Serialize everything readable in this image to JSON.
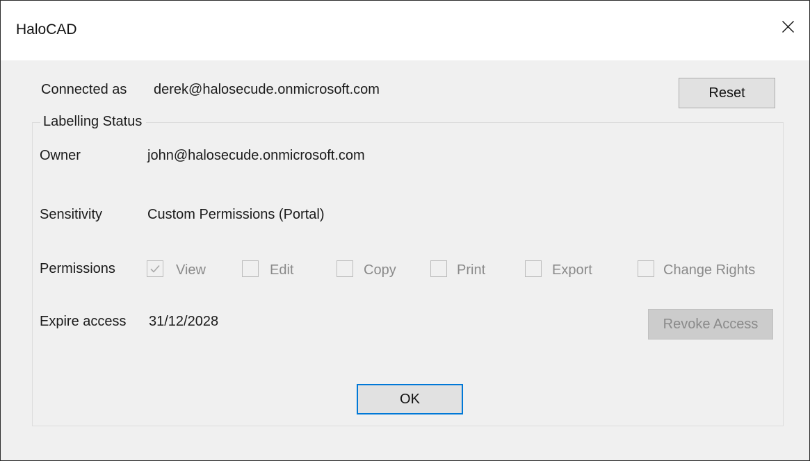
{
  "window": {
    "title": "HaloCAD",
    "close_icon": "close-icon"
  },
  "connection": {
    "label": "Connected as",
    "value": "derek@halosecude.onmicrosoft.com"
  },
  "buttons": {
    "reset": "Reset",
    "revoke": "Revoke Access",
    "ok": "OK"
  },
  "group": {
    "title": "Labelling Status",
    "owner_label": "Owner",
    "owner_value": "john@halosecude.onmicrosoft.com",
    "sensitivity_label": "Sensitivity",
    "sensitivity_value": "Custom Permissions (Portal)",
    "permissions_label": "Permissions",
    "permissions": [
      {
        "label": "View",
        "checked": true,
        "enabled": false
      },
      {
        "label": "Edit",
        "checked": false,
        "enabled": false
      },
      {
        "label": "Copy",
        "checked": false,
        "enabled": false
      },
      {
        "label": "Print",
        "checked": false,
        "enabled": false
      },
      {
        "label": "Export",
        "checked": false,
        "enabled": false
      },
      {
        "label": "Change Rights",
        "checked": false,
        "enabled": false
      }
    ],
    "expire_label": "Expire access",
    "expire_value": "31/12/2028"
  },
  "colors": {
    "window_bg": "#f0f0f0",
    "default_button_border": "#0078d7",
    "disabled_text": "#8a8a8a"
  }
}
